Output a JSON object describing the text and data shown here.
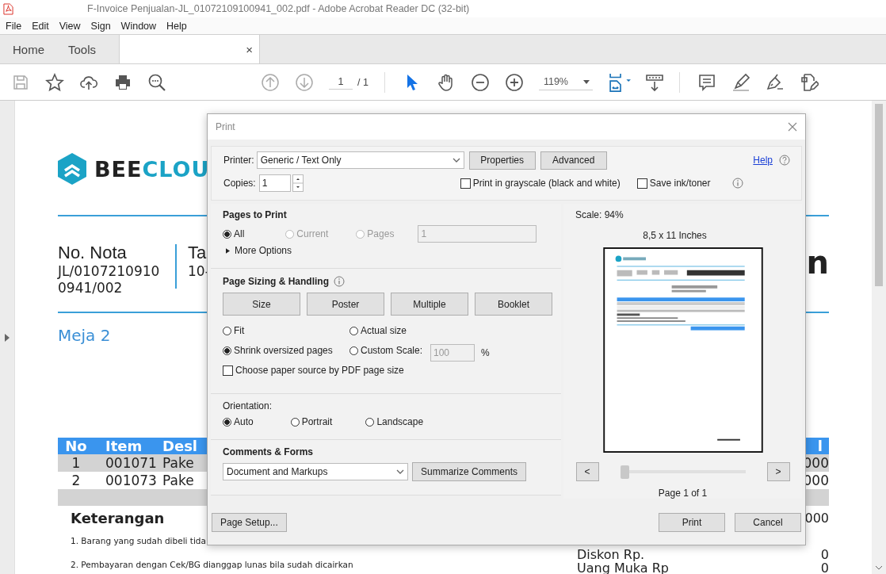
{
  "window": {
    "title": "F-Invoice Penjualan-JL_01072109100941_002.pdf - Adobe Acrobat Reader DC (32-bit)"
  },
  "menu": [
    "File",
    "Edit",
    "View",
    "Sign",
    "Window",
    "Help"
  ],
  "tabs": [
    {
      "label": "Home",
      "selected": false
    },
    {
      "label": "Tools",
      "selected": false
    }
  ],
  "document_tab": {
    "selected": true,
    "close": "×"
  },
  "toolbar": {
    "tools": [
      {
        "kind": "select",
        "selected": true
      },
      {
        "kind": "hand",
        "selected": false
      }
    ],
    "page": "1",
    "page_total": "/ 1",
    "zoom": "119%"
  },
  "document": {
    "logo_dark": "BEE",
    "logo_accent": "CLOU",
    "nota_label": "No. Nota",
    "nota_lines": [
      "JL/0107210910",
      "0941/002"
    ],
    "date_label": "Ta",
    "date_value": "10-",
    "title": "n",
    "table_label": "Meja 2",
    "header": [
      "No",
      "Item",
      "Desl"
    ],
    "header_last": "l",
    "rows": [
      {
        "no": "1",
        "item": "001071",
        "desc": "Pake",
        "last": "000"
      },
      {
        "no": "2",
        "item": "001073",
        "desc": "Pake",
        "last": "000"
      }
    ],
    "notes_title": "Keterangan",
    "notes": [
      "1. Barang yang sudah dibeli tida",
      "2. Pembayaran dengan Cek/BG dianggap lunas bila sudah dicairkan"
    ],
    "subtotal_value": "000",
    "totals": [
      {
        "label": "Diskon Rp.",
        "value": "0"
      },
      {
        "label": "Uang Muka Rp",
        "value": "0"
      }
    ]
  },
  "print_dialog": {
    "title": "Print",
    "printer_label": "Printer:",
    "printer": "Generic / Text Only",
    "top_buttons": [
      "Properties",
      "Advanced"
    ],
    "help": "Help",
    "copies_label": "Copies:",
    "copies": "1",
    "options": [
      {
        "label": "Print in grayscale (black and white)",
        "checked": false
      },
      {
        "label": "Save ink/toner",
        "checked": false
      }
    ],
    "pages_to_print": {
      "title": "Pages to Print",
      "options": [
        {
          "label": "All",
          "selected": true,
          "disabled": false
        },
        {
          "label": "Current",
          "selected": false,
          "disabled": true
        },
        {
          "label": "Pages",
          "selected": false,
          "disabled": true
        }
      ],
      "range": "1",
      "more_options": "More Options",
      "more_expanded": false
    },
    "sizing": {
      "title": "Page Sizing & Handling",
      "modes": [
        "Size",
        "Poster",
        "Multiple",
        "Booklet"
      ],
      "scale_options": [
        {
          "label": "Fit",
          "selected": false
        },
        {
          "label": "Actual size",
          "selected": false
        },
        {
          "label": "Shrink oversized pages",
          "selected": true
        },
        {
          "label": "Custom Scale:",
          "selected": false
        }
      ],
      "custom_scale": "100",
      "percent": "%",
      "paper_source": {
        "label": "Choose paper source by PDF page size",
        "checked": false
      }
    },
    "orientation": {
      "title": "Orientation:",
      "options": [
        {
          "label": "Auto",
          "selected": true
        },
        {
          "label": "Portrait",
          "selected": false
        },
        {
          "label": "Landscape",
          "selected": false
        }
      ]
    },
    "comments": {
      "title": "Comments & Forms",
      "value": "Document and Markups",
      "button": "Summarize Comments"
    },
    "preview": {
      "scale": "Scale:  94%",
      "paper": "8,5 x 11 Inches",
      "prev": "<",
      "next": ">",
      "slider": {
        "level": 0
      },
      "page": "Page 1 of 1"
    },
    "footer": {
      "page_setup": "Page Setup...",
      "print": "Print",
      "cancel": "Cancel"
    }
  }
}
